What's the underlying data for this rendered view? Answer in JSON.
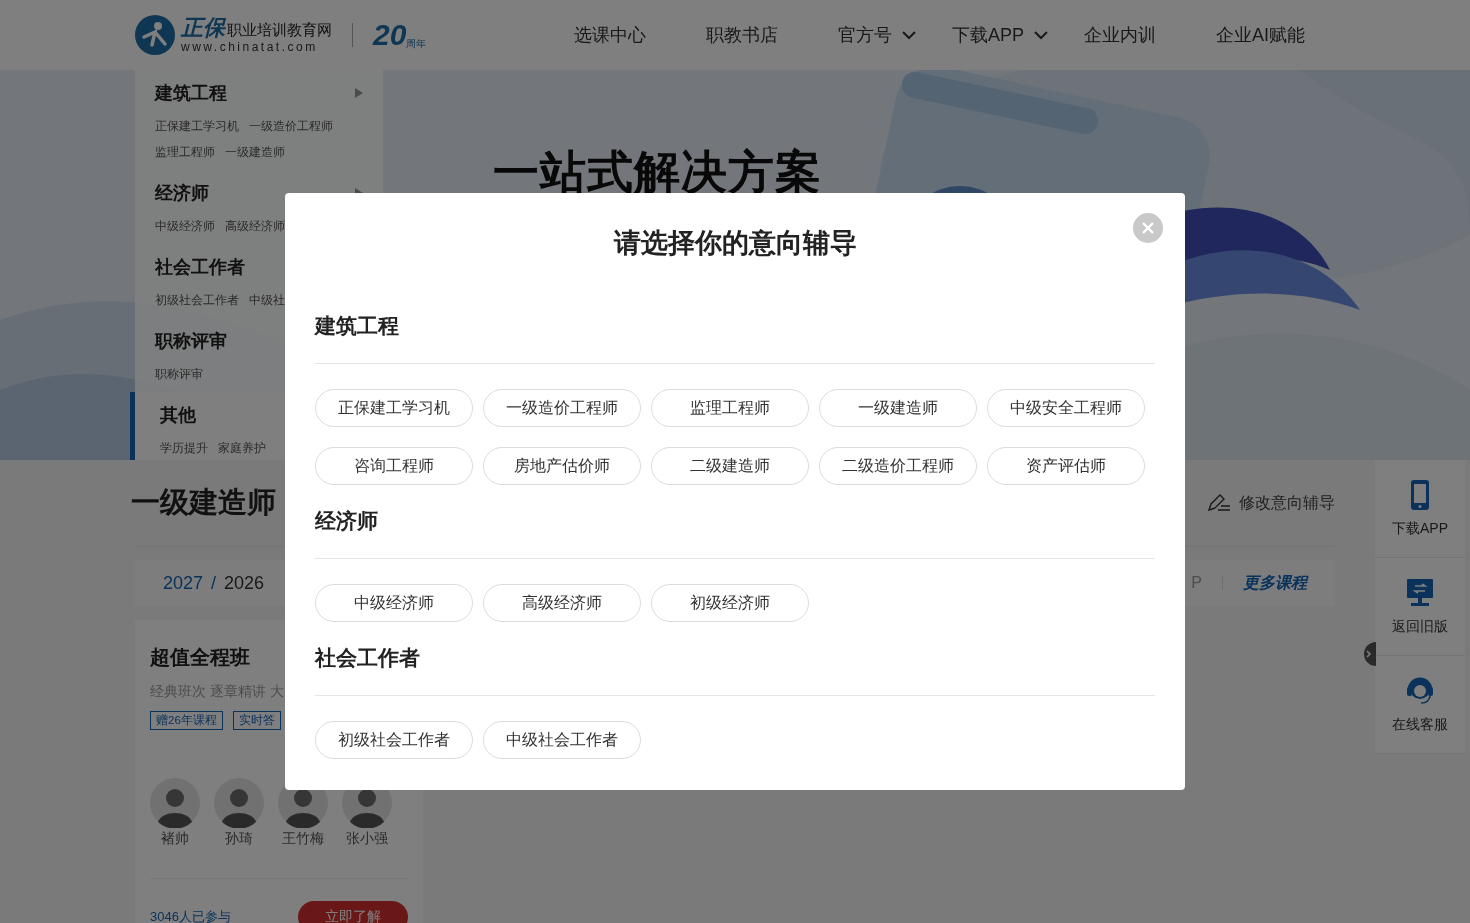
{
  "header": {
    "logo": {
      "brand": "正保",
      "name": "职业培训教育网",
      "url": "www.chinatat.com",
      "anniversary": "20",
      "anniversary_suffix": "周年"
    },
    "nav": [
      {
        "label": "选课中心",
        "dropdown": false
      },
      {
        "label": "职教书店",
        "dropdown": false
      },
      {
        "label": "官方号",
        "dropdown": true
      },
      {
        "label": "下载APP",
        "dropdown": true
      },
      {
        "label": "企业内训",
        "dropdown": false
      },
      {
        "label": "企业AI赋能",
        "dropdown": false
      }
    ]
  },
  "sidebar": {
    "items": [
      {
        "title": "建筑工程",
        "arrow": true,
        "selected": false,
        "links": [
          "正保建工学习机",
          "一级造价工程师",
          "监理工程师",
          "一级建造师"
        ]
      },
      {
        "title": "经济师",
        "arrow": true,
        "selected": false,
        "links": [
          "中级经济师",
          "高级经济师"
        ]
      },
      {
        "title": "社会工作者",
        "selected": false,
        "links": [
          "初级社会工作者",
          "中级社"
        ]
      },
      {
        "title": "职称评审",
        "selected": false,
        "links": [
          "职称评审"
        ]
      },
      {
        "title": "其他",
        "selected": true,
        "links": [
          "学历提升",
          "家庭养护"
        ]
      }
    ]
  },
  "banner": {
    "headline": "一站式解决方案"
  },
  "page_title": "一级建造师",
  "edit_link": "修改意向辅导",
  "year_tabs": [
    {
      "label": "2027",
      "selected": true
    },
    {
      "label": "2026",
      "selected": false
    }
  ],
  "year_separator": "/",
  "course_tab_tail": "P",
  "more_courses": "更多课程",
  "course_card": {
    "title": "超值全程班",
    "description": "经典班次 逐章精讲 大",
    "tags": [
      "赠26年课程",
      "实时答"
    ],
    "teachers": [
      "褚帅",
      "孙琦",
      "王竹梅",
      "张小强"
    ],
    "participants": "3046人已参与",
    "cta": "立即了解"
  },
  "side_toolbar": [
    {
      "label": "下载APP",
      "kind": "phone"
    },
    {
      "label": "返回旧版",
      "kind": "monitor"
    },
    {
      "label": "在线客服",
      "kind": "headset"
    }
  ],
  "dialog": {
    "title": "请选择你的意向辅导",
    "sections": [
      {
        "title": "建筑工程",
        "options": [
          "正保建工学习机",
          "一级造价工程师",
          "监理工程师",
          "一级建造师",
          "中级安全工程师",
          "咨询工程师",
          "房地产估价师",
          "二级建造师",
          "二级造价工程师",
          "资产评估师"
        ]
      },
      {
        "title": "经济师",
        "options": [
          "中级经济师",
          "高级经济师",
          "初级经济师"
        ]
      },
      {
        "title": "社会工作者",
        "options": [
          "初级社会工作者",
          "中级社会工作者"
        ]
      }
    ]
  }
}
